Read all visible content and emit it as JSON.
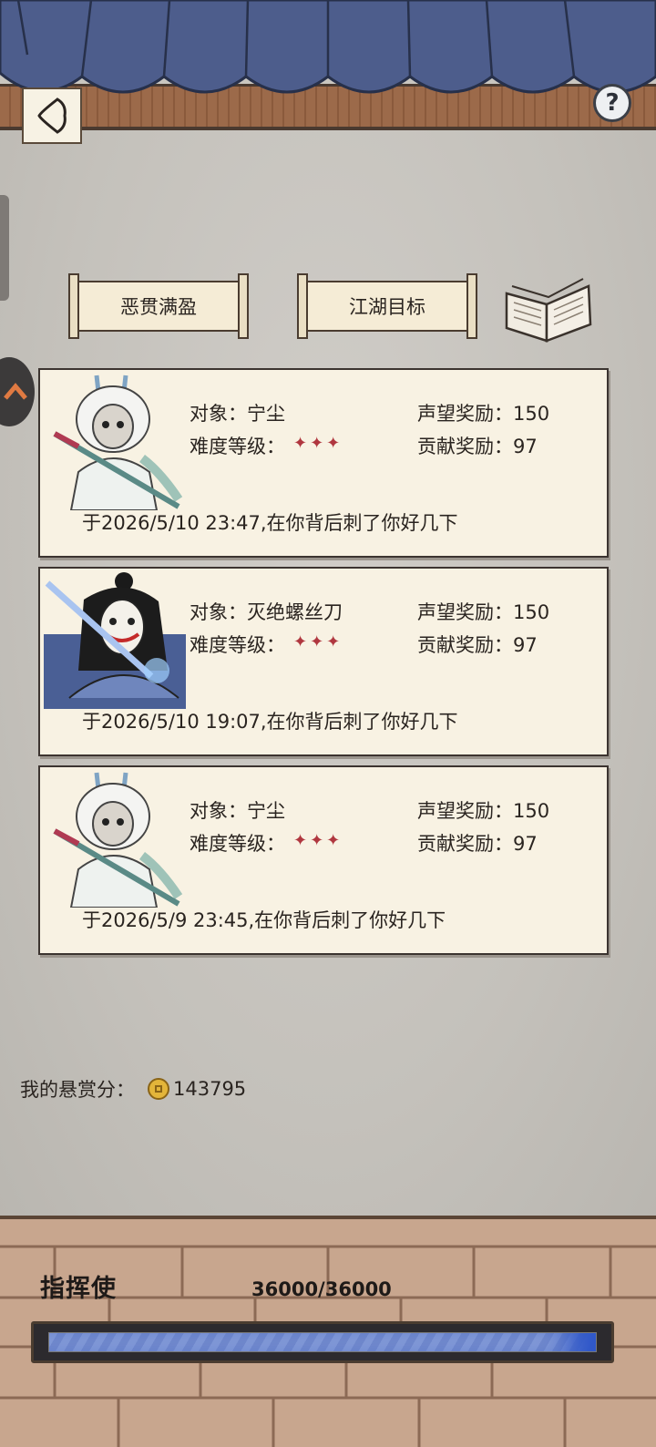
{
  "header": {
    "back_icon": "back-arrow-icon",
    "help_label": "?"
  },
  "tabs": [
    {
      "label": "恶贯满盈"
    },
    {
      "label": "江湖目标"
    }
  ],
  "labels": {
    "target": "对象：",
    "difficulty": "难度等级：",
    "reputation": "声望奖励：",
    "contribution": "贡献奖励："
  },
  "cards": [
    {
      "avatar": "white-haired-swordsman",
      "target": "宁尘",
      "stars": "✦✦✦",
      "reputation": "150",
      "contribution": "97",
      "message": "于2026/5/10 23:47,在你背后刺了你好几下"
    },
    {
      "avatar": "masked-black-haired-swordsman",
      "target": "灭绝螺丝刀",
      "stars": "✦✦✦",
      "reputation": "150",
      "contribution": "97",
      "message": "于2026/5/10 19:07,在你背后刺了你好几下"
    },
    {
      "avatar": "white-haired-swordsman",
      "target": "宁尘",
      "stars": "✦✦✦",
      "reputation": "150",
      "contribution": "97",
      "message": "于2026/5/9 23:45,在你背后刺了你好几下"
    }
  ],
  "bounty": {
    "label": "我的悬赏分：",
    "value": "143795",
    "icon": "coin-icon"
  },
  "rank": {
    "title": "指挥使",
    "exp_text": "36000/36000",
    "progress": 1.0
  },
  "colors": {
    "awning": "#4a5a86",
    "star": "#b0373f",
    "card_bg": "#f8f2e3",
    "progress": "#2f57c9"
  }
}
